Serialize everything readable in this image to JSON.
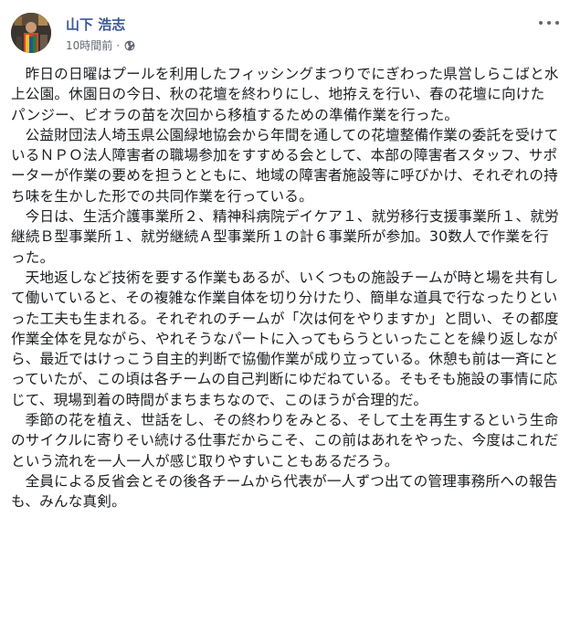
{
  "post": {
    "author_name": "山下 浩志",
    "timestamp": "10時間前",
    "separator": "·",
    "privacy_icon": "globe-icon",
    "more_icon": "more-options-icon",
    "paragraphs": [
      "昨日の日曜はプールを利用したフィッシングまつりでにぎわった県営しらこばと水上公園。休園日の今日、秋の花壇を終わりにし、地拵えを行い、春の花壇に向けたパンジー、ビオラの苗を次回から移植するための準備作業を行った。",
      "公益財団法人埼玉県公園緑地協会から年間を通しての花壇整備作業の委託を受けているＮＰＯ法人障害者の職場参加をすすめる会として、本部の障害者スタッフ、サポーターが作業の要めを担うとともに、地域の障害者施設等に呼びかけ、それぞれの持ち味を生かした形での共同作業を行っている。",
      "今日は、生活介護事業所２、精神科病院デイケア１、就労移行支援事業所１、就労継続Ｂ型事業所１、就労継続Ａ型事業所１の計６事業所が参加。30数人で作業を行った。",
      "天地返しなど技術を要する作業もあるが、いくつもの施設チームが時と場を共有して働いていると、その複雑な作業自体を切り分けたり、簡単な道具で行なったりといった工夫も生まれる。それぞれのチームが「次は何をやりますか」と問い、その都度作業全体を見ながら、やれそうなパートに入ってもらうといったことを繰り返しながら、最近ではけっこう自主的判断で協働作業が成り立っている。休憩も前は一斉にとっていたが、この頃は各チームの自己判断にゆだねている。そもそも施設の事情に応じて、現場到着の時間がまちまちなので、このほうが合理的だ。",
      "季節の花を植え、世話をし、その終わりをみとる、そして土を再生するという生命のサイクルに寄りそい続ける仕事だからこそ、この前はあれをやった、今度はこれだという流れを一人一人が感じ取りやすいこともあるだろう。",
      "全員による反省会とその後各チームから代表が一人ずつ出ての管理事務所への報告も、みんな真剣。"
    ]
  },
  "colors": {
    "author": "#385898",
    "meta": "#616770",
    "text": "#1c1e21",
    "background": "#ffffff"
  }
}
